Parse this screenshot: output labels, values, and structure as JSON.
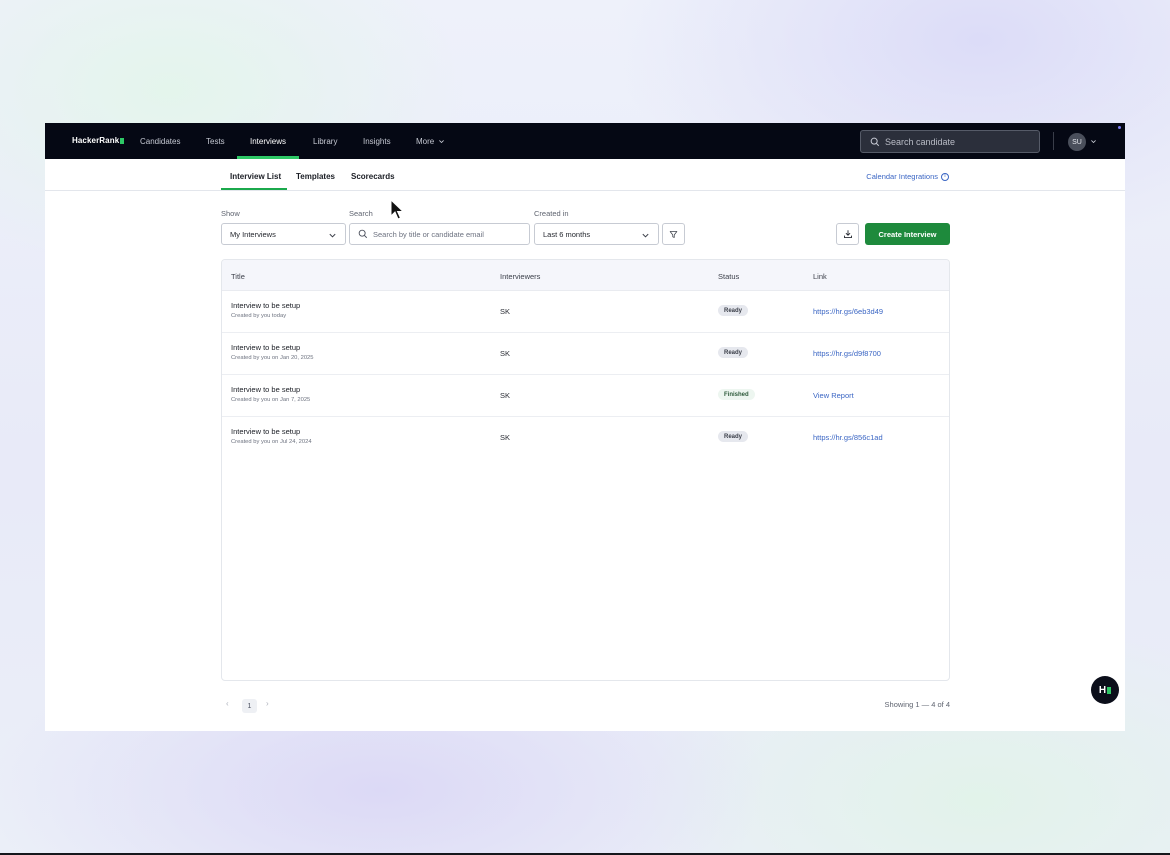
{
  "nav": {
    "brand": "HackerRank",
    "items": [
      {
        "label": "Candidates"
      },
      {
        "label": "Tests"
      },
      {
        "label": "Interviews"
      },
      {
        "label": "Library"
      },
      {
        "label": "Insights"
      },
      {
        "label": "More"
      }
    ],
    "search_placeholder": "Search candidate",
    "avatar_initials": "SU"
  },
  "subnav": {
    "tabs": [
      {
        "label": "Interview List"
      },
      {
        "label": "Templates"
      },
      {
        "label": "Scorecards"
      }
    ],
    "calendar_link": "Calendar Integrations",
    "info_glyph": "i"
  },
  "filters": {
    "show_label": "Show",
    "show_value": "My Interviews",
    "search_label": "Search",
    "search_placeholder": "Search by title or candidate email",
    "created_label": "Created in",
    "created_value": "Last 6 months",
    "create_button": "Create Interview"
  },
  "table": {
    "headers": [
      "Title",
      "Interviewers",
      "Status",
      "Link"
    ],
    "rows": [
      {
        "title": "Interview to be setup",
        "subtitle": "Created by you today",
        "interviewers": "SK",
        "status": "Ready",
        "link": "https://hr.gs/6eb3d49"
      },
      {
        "title": "Interview to be setup",
        "subtitle": "Created by you on Jan 20, 2025",
        "interviewers": "SK",
        "status": "Ready",
        "link": "https://hr.gs/d9f8700"
      },
      {
        "title": "Interview to be setup",
        "subtitle": "Created by you on Jan 7, 2025",
        "interviewers": "SK",
        "status": "Finished",
        "link": "View Report"
      },
      {
        "title": "Interview to be setup",
        "subtitle": "Created by you on Jul 24, 2024",
        "interviewers": "SK",
        "status": "Ready",
        "link": "https://hr.gs/856c1ad"
      }
    ]
  },
  "pagination": {
    "prev_glyph": "‹",
    "current_page": "1",
    "next_glyph": "›",
    "summary": "Showing 1 — 4 of 4"
  },
  "help": {
    "label": "H"
  },
  "colors": {
    "nav_bg": "#050814",
    "accent_green": "#1e8a3c",
    "brand_green": "#2ec866",
    "link_blue": "#3b66c4"
  },
  "icons": [
    "search-icon",
    "chevron-down-icon",
    "info-icon",
    "filter-icon",
    "download-icon",
    "help-icon",
    "mouse-pointer-icon"
  ]
}
